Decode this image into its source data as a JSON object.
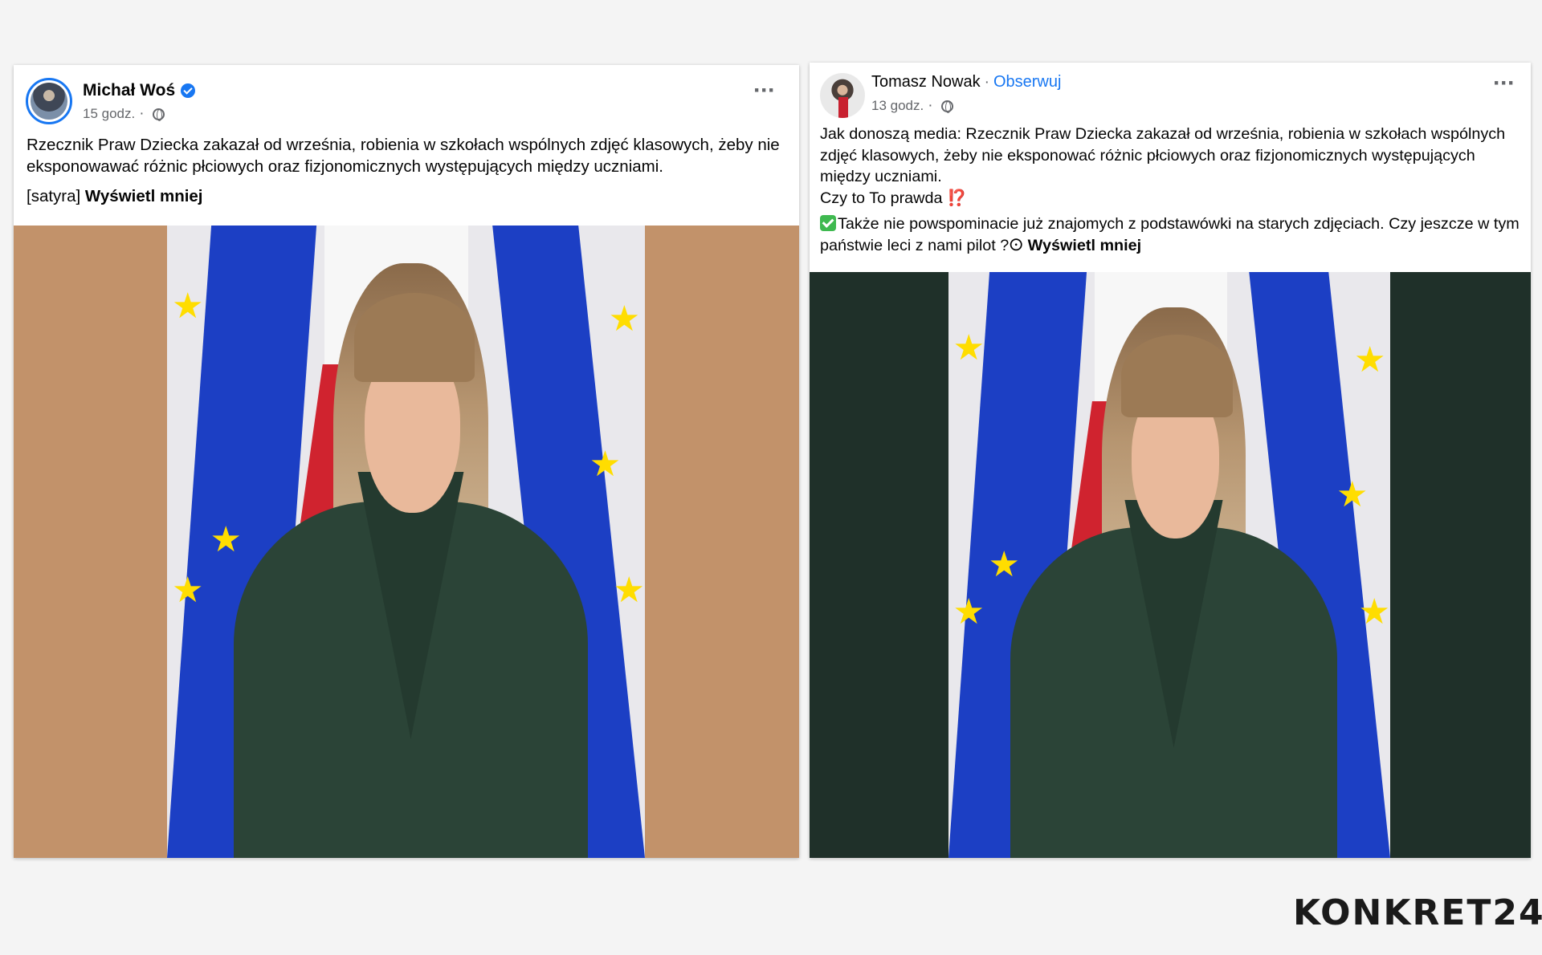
{
  "left_post": {
    "author": "Michał Woś",
    "time": "15 godz.",
    "separator": "·",
    "text": "Rzecznik Praw Dziecka zakazał od września, robienia w szkołach wspólnych zdjęć klasowych, żeby nie eksponowawać różnic płciowych oraz fizjonomicznych występujących między uczniami.",
    "tag": "[satyra]",
    "show_less": "Wyświetl mniej",
    "more_icon": "···"
  },
  "right_post": {
    "author": "Tomasz Nowak",
    "separator": "·",
    "follow": "Obserwuj",
    "time": "13 godz.",
    "text_line1": "Jak donoszą media: Rzecznik Praw Dziecka zakazał od września, robienia w szkołach wspólnych zdjęć klasowych, żeby nie eksponować różnic płciowych oraz fizjonomicznych występujących między uczniami.",
    "text_line2": "Czy to To prawda",
    "text_line2_emoji": "⁉️",
    "text_line3": "Także nie powspominacie już znajomych z podstawówki na starych zdjęciach.  Czy jeszcze w tym państwie leci z nami pilot ?",
    "text_line3_glyph": "𐌏",
    "show_less": "Wyświetl mniej",
    "more_icon": "···"
  },
  "logo": "KONKRET24",
  "colors": {
    "facebook_blue": "#1877f2",
    "left_photo_background": "#c2926a",
    "right_photo_background": "#1f3029"
  }
}
